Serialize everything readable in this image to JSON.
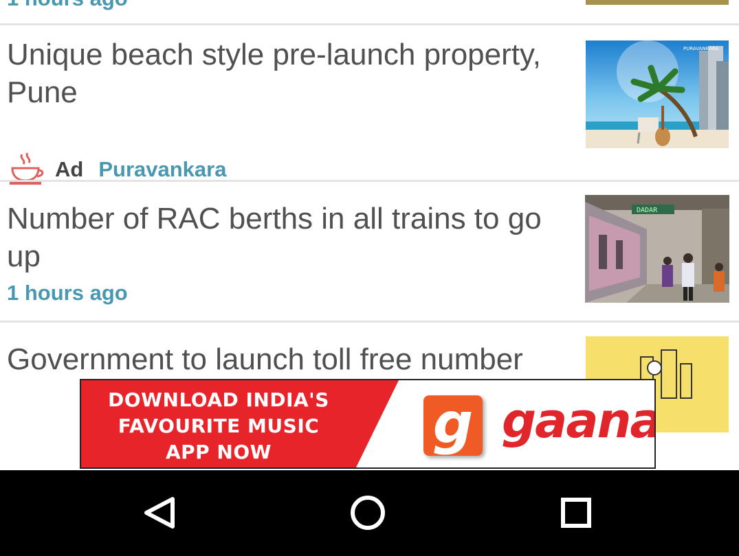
{
  "feed": {
    "top_partial": {
      "time": "1 hours ago"
    },
    "items": [
      {
        "title": "Unique beach style pre-launch property, Pune",
        "ad_tag": "Ad",
        "source": "Puravankara",
        "thumb_caption": "PURAVANKARA"
      },
      {
        "title": "Number of RAC berths in all trains to go up",
        "time": "1 hours ago",
        "thumb_caption": "DADAR"
      },
      {
        "title": "Government to launch toll free number"
      }
    ]
  },
  "banner": {
    "lines": [
      "DOWNLOAD INDIA'S",
      "FAVOURITE MUSIC",
      "APP NOW"
    ],
    "logo_letter": "g",
    "brand": "gaana"
  },
  "navbar": {
    "icons": [
      "back-icon",
      "home-icon",
      "recents-icon"
    ]
  },
  "colors": {
    "link": "#4a98b0",
    "title": "#505050",
    "banner_red": "#e8242b",
    "gaana_orange": "#f05a24"
  }
}
